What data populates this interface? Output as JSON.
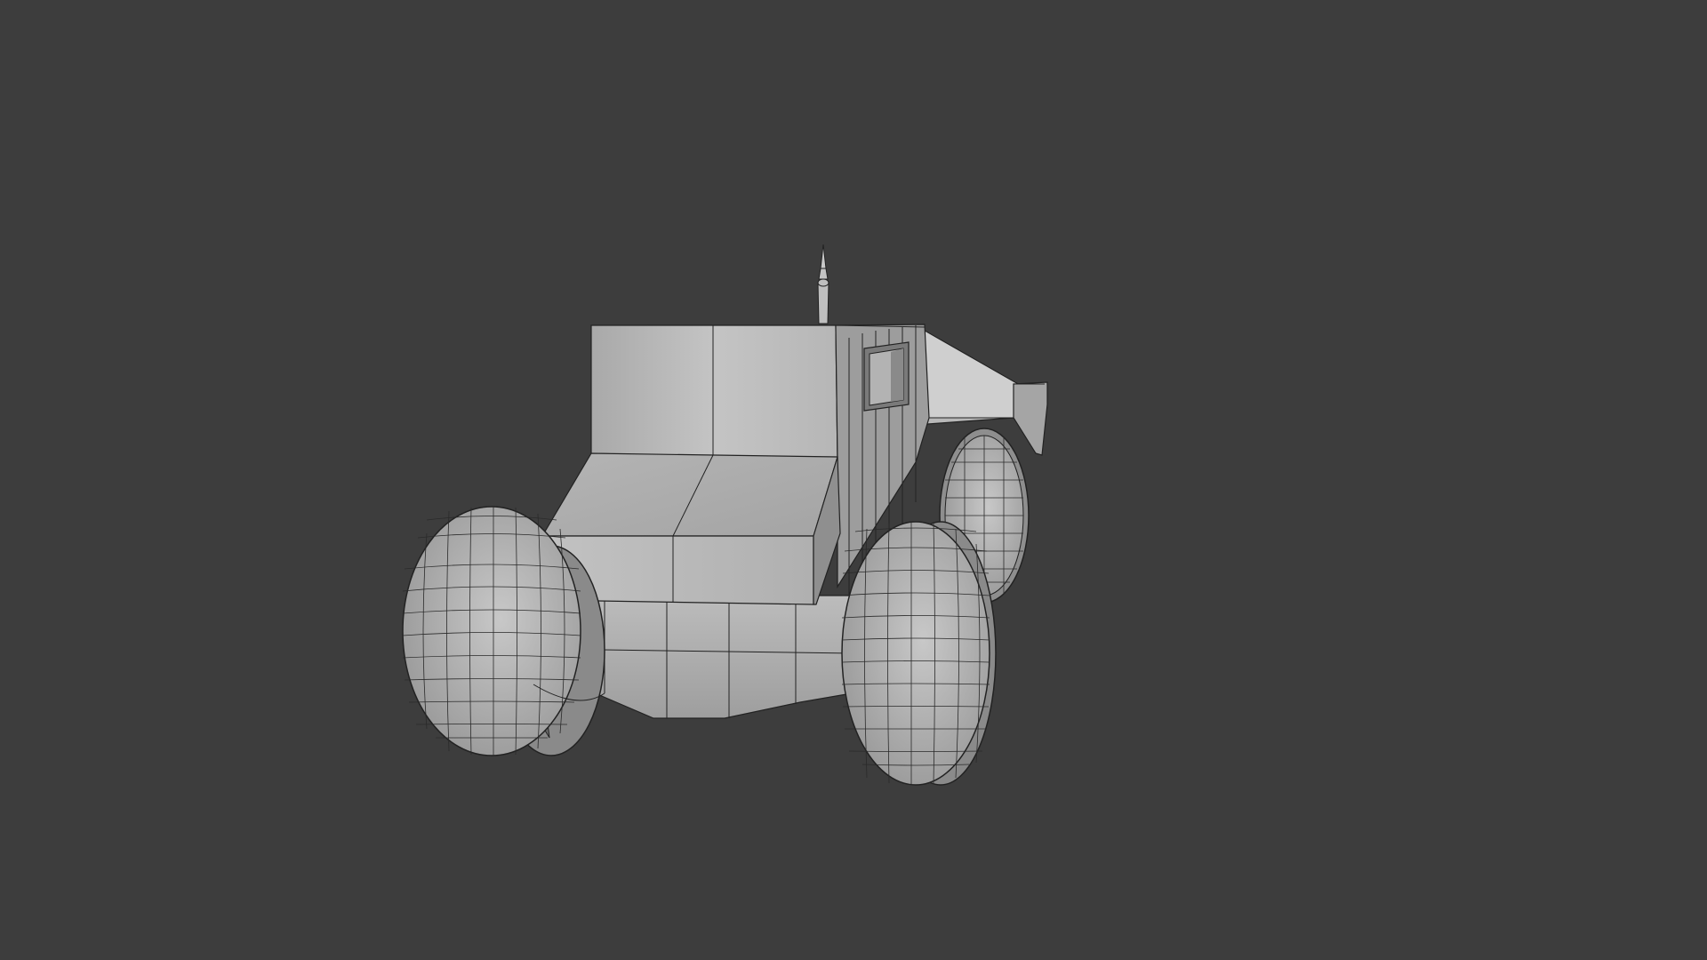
{
  "viewport": {
    "background": "#3d3d3d",
    "object_fill": "#bdbdbd",
    "wire_color": "#1e1e1e"
  },
  "scene": {
    "object": "vehicle-mesh",
    "parts": [
      "antenna",
      "cabin",
      "hood",
      "spoiler",
      "front-bumper",
      "wheel-front-left",
      "wheel-front-right",
      "wheel-rear-right"
    ]
  }
}
